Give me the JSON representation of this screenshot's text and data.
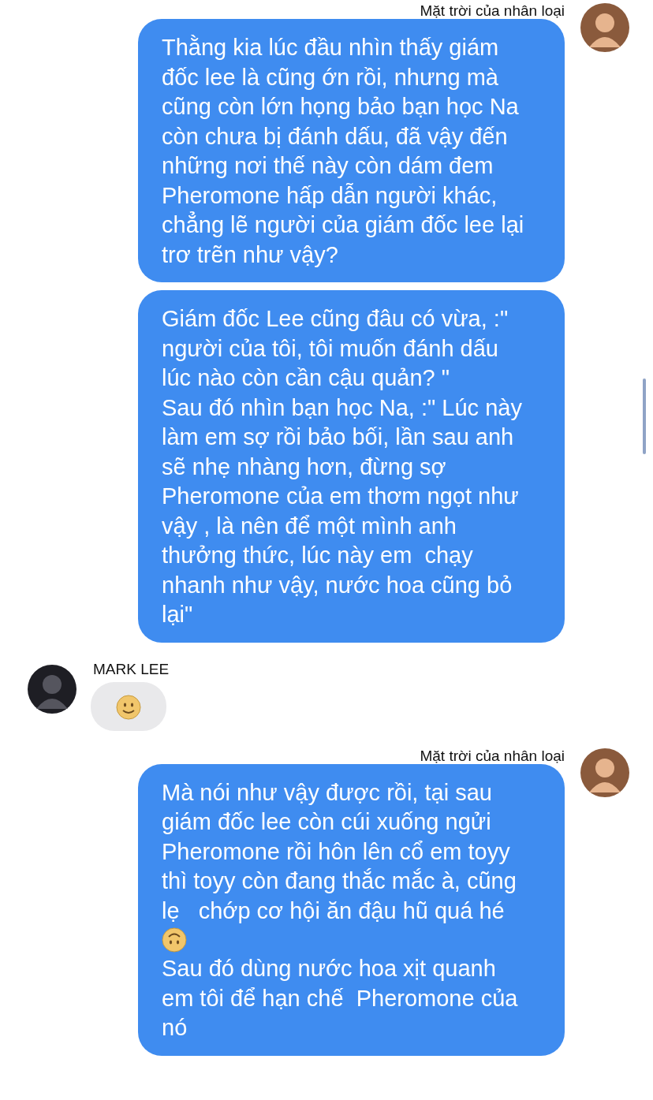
{
  "groups": [
    {
      "outgoing": true,
      "sender": "Mặt trời của nhân loại",
      "messages": [
        {
          "parts": [
            {
              "kind": "text",
              "text": "Thằng kia lúc đầu nhìn thấy giám đốc lee là cũng ớn rồi, nhưng mà cũng còn lớn họng bảo bạn học Na còn chưa bị đánh dấu, đã vậy đến những nơi thế này còn dám đem Pheromone hấp dẫn người khác, chẳng lẽ người của giám đốc lee lại trơ trẽn như vậy?"
            }
          ]
        },
        {
          "parts": [
            {
              "kind": "text",
              "text": "Giám đốc Lee cũng đâu có vừa, :\" người của tôi, tôi muốn đánh dấu lúc nào còn cần cậu quản? \""
            },
            {
              "kind": "text",
              "text": "Sau đó nhìn bạn học Na, :\" Lúc này làm em sợ rồi bảo bối, lần sau anh sẽ nhẹ nhàng hơn, đừng sợ Pheromone của em thơm ngọt như vậy , là nên để một mình anh thưởng thức, lúc này em  chạy nhanh như vậy, nước hoa cũng bỏ lại\""
            }
          ]
        }
      ]
    },
    {
      "outgoing": false,
      "sender": "MARK LEE",
      "messages": [
        {
          "parts": [
            {
              "kind": "smile"
            }
          ]
        }
      ]
    },
    {
      "outgoing": true,
      "sender": "Mặt trời của nhân loại",
      "messages": [
        {
          "parts": [
            {
              "kind": "text",
              "text": "Mà nói như vậy được rồi, tại sau giám đốc lee còn cúi xuống ngửi Pheromone rồi hôn lên cổ em toyy thì toyy còn đang thắc mắc à, cũng lẹ   chớp cơ hội ăn đậu hũ quá hé"
            },
            {
              "kind": "upside_down"
            },
            {
              "kind": "text",
              "text": "Sau đó dùng nước hoa xịt quanh em tôi để hạn chế  Pheromone của nó"
            }
          ]
        }
      ]
    }
  ]
}
